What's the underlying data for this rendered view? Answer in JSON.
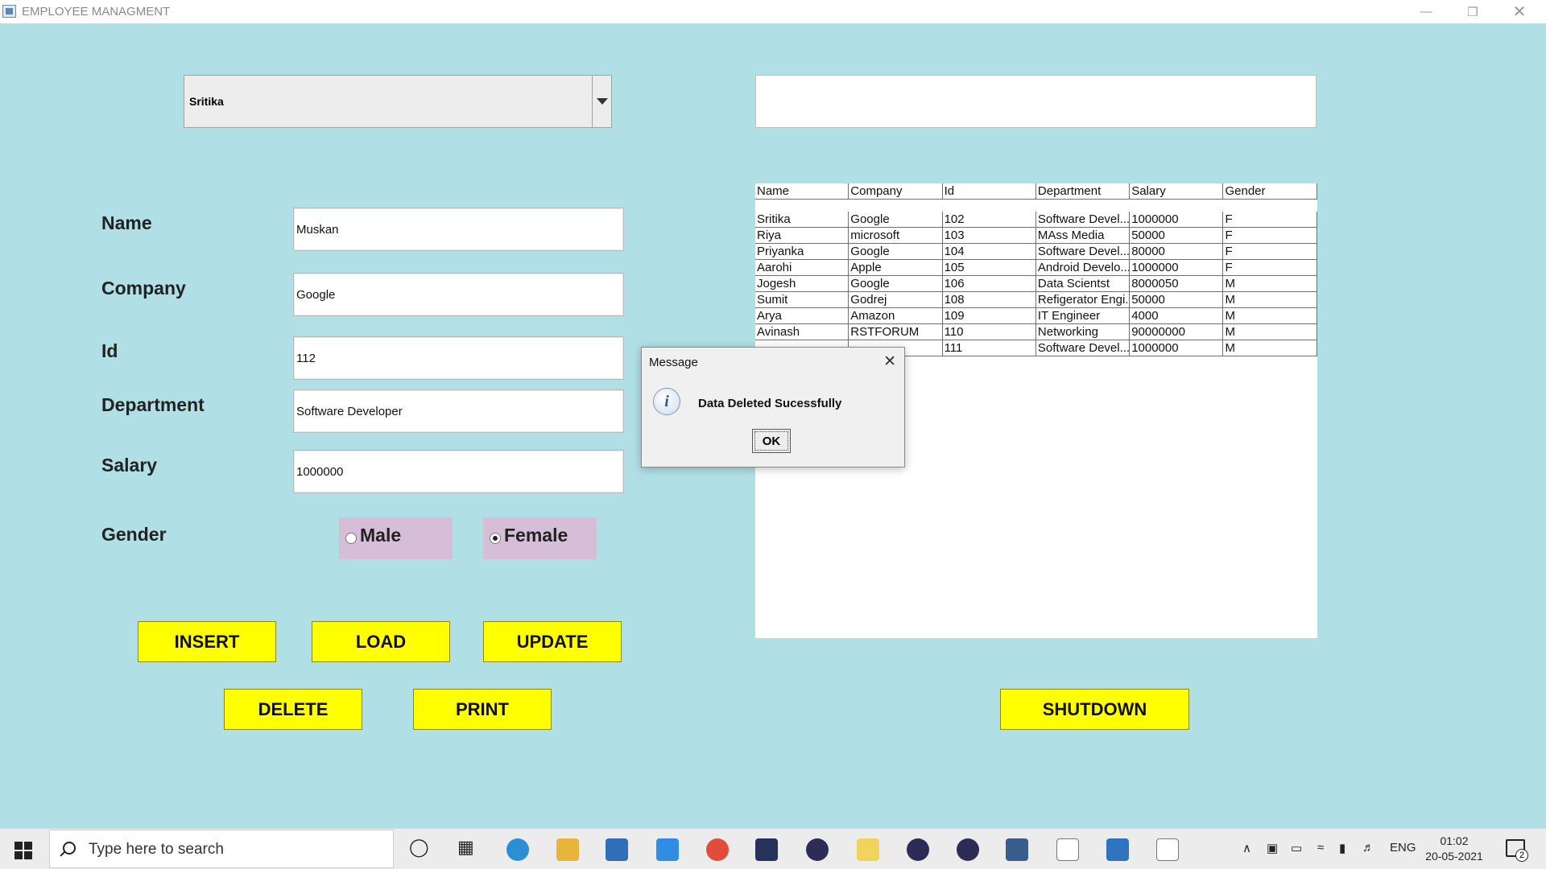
{
  "window": {
    "title": "EMPLOYEE MANAGMENT"
  },
  "combo": {
    "selected": "Sritika"
  },
  "form": {
    "name_label": "Name",
    "name_value": "Muskan",
    "company_label": "Company",
    "company_value": "Google",
    "id_label": "Id",
    "id_value": "112",
    "department_label": "Department",
    "department_value": "Software Developer",
    "salary_label": "Salary",
    "salary_value": "1000000",
    "gender_label": "Gender",
    "gender_male": "Male",
    "gender_female": "Female",
    "gender_selected": "Female"
  },
  "buttons": {
    "insert": "INSERT",
    "load": "LOAD",
    "update": "UPDATE",
    "delete": "DELETE",
    "print": "PRINT",
    "shutdown": "SHUTDOWN"
  },
  "table": {
    "headers": [
      "Name",
      "Company",
      "Id",
      "Department",
      "Salary",
      "Gender"
    ],
    "rows": [
      [
        "Sritika",
        "Google",
        "102",
        "Software Devel...",
        "1000000",
        "F"
      ],
      [
        "Riya",
        "microsoft",
        "103",
        "MAss Media",
        "50000",
        "F"
      ],
      [
        "Priyanka",
        "Google",
        "104",
        "Software Devel...",
        "80000",
        "F"
      ],
      [
        "Aarohi",
        "Apple",
        "105",
        "Android Develo...",
        "1000000",
        "F"
      ],
      [
        "Jogesh",
        "Google",
        "106",
        "Data Scientst",
        "8000050",
        "M"
      ],
      [
        "Sumit",
        "Godrej",
        "108",
        "Refigerator Engi...",
        "50000",
        "M"
      ],
      [
        "Arya",
        "Amazon",
        "109",
        "IT Engineer",
        "4000",
        "M"
      ],
      [
        "Avinash",
        "RSTFORUM",
        "110",
        "Networking",
        "90000000",
        "M"
      ],
      [
        "",
        "",
        "111",
        "Software Devel...",
        "1000000",
        "M"
      ]
    ]
  },
  "dialog": {
    "title": "Message",
    "message": "Data Deleted Sucessfully",
    "ok_label": "OK",
    "icon": "info-icon"
  },
  "taskbar": {
    "search_placeholder": "Type here to search",
    "language": "ENG",
    "time": "01:02",
    "date": "20-05-2021",
    "notification_count": "2"
  },
  "colors": {
    "background": "#b0dfe5",
    "button": "#ffff00",
    "radio_bg": "#d7bed8"
  }
}
